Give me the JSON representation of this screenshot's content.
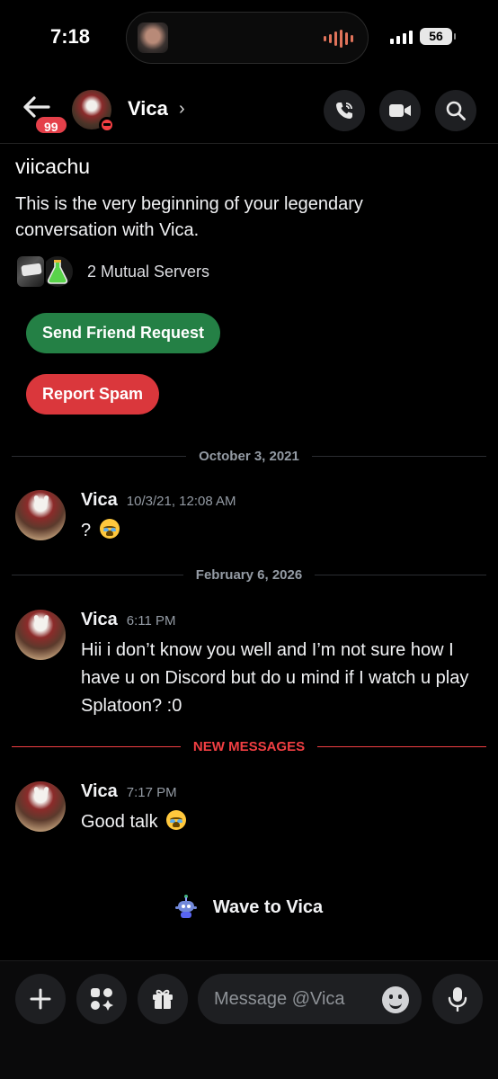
{
  "status_bar": {
    "time": "7:18",
    "battery": "56"
  },
  "header": {
    "name": "Vica",
    "chevron": "›",
    "unread_badge": "99",
    "icons": [
      "back-arrow-icon",
      "phone-call-icon",
      "video-camera-icon",
      "search-icon"
    ]
  },
  "intro": {
    "username": "viicachu",
    "text": "This is the very beginning of your legendary conversation with Vica.",
    "mutual_servers": "2 Mutual Servers",
    "add_friend_label": "Send Friend Request",
    "report_label": "Report Spam"
  },
  "dividers": {
    "d1": "October 3, 2021",
    "d2": "February 6, 2026",
    "new_messages": "NEW MESSAGES"
  },
  "messages": [
    {
      "author": "Vica",
      "timestamp": "10/3/21, 12:08 AM",
      "text": "?"
    },
    {
      "author": "Vica",
      "timestamp": "6:11 PM",
      "text": "Hii i don’t know you well and I’m not sure how I have u on Discord but do u mind if I watch u play Splatoon? :0"
    },
    {
      "author": "Vica",
      "timestamp": "7:17 PM",
      "text": "Good talk"
    }
  ],
  "wave": {
    "label": "Wave to Vica"
  },
  "composer": {
    "placeholder": "Message @Vica",
    "icons": [
      "plus-icon",
      "apps-icon",
      "gift-icon",
      "emoji-icon",
      "microphone-icon"
    ]
  },
  "colors": {
    "background": "#000000",
    "green": "#248045",
    "red": "#da373c",
    "new_messages": "#f23f43",
    "badge": "#e5404a"
  }
}
